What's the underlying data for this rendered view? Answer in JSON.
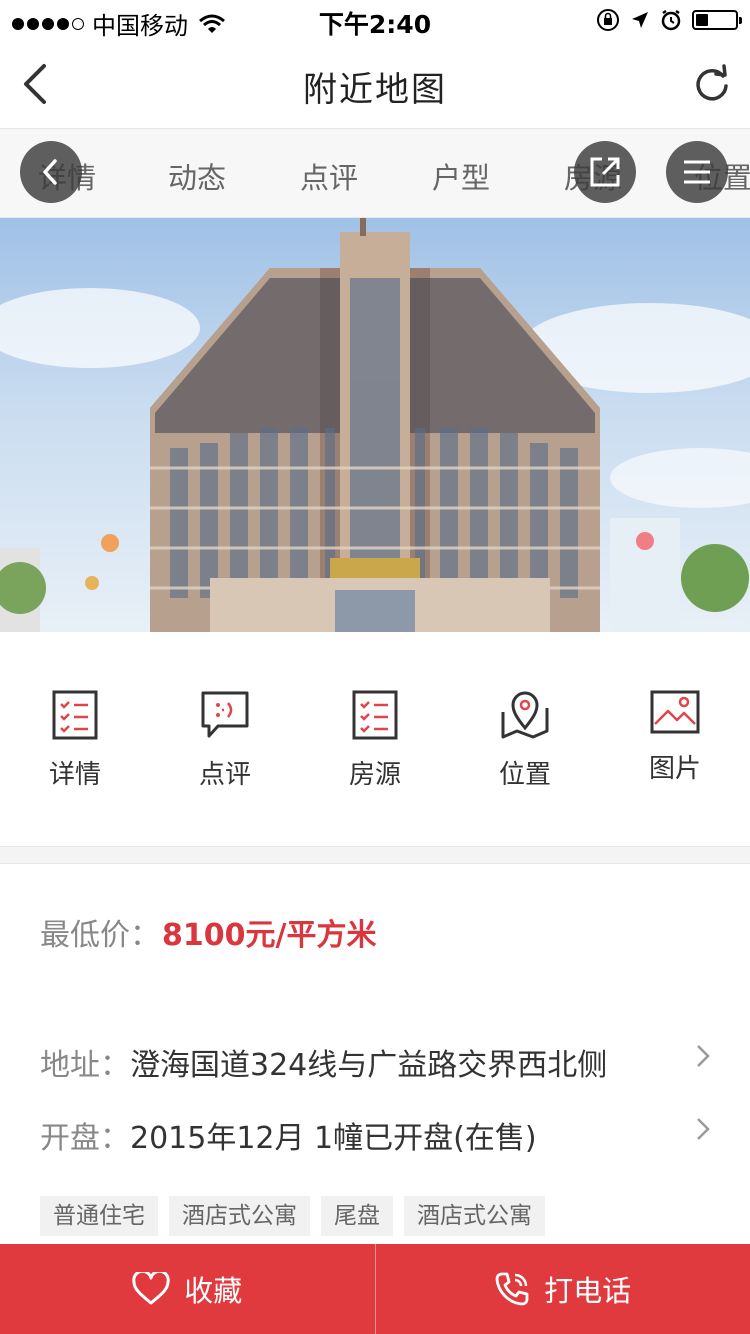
{
  "status_bar": {
    "carrier": "中国移动",
    "time": "下午2:40"
  },
  "nav": {
    "title": "附近地图"
  },
  "tabs": [
    "详情",
    "动态",
    "点评",
    "户型",
    "房源",
    "位置"
  ],
  "quick_actions": [
    {
      "label": "详情",
      "icon": "list-icon"
    },
    {
      "label": "点评",
      "icon": "comment-icon"
    },
    {
      "label": "房源",
      "icon": "list-icon"
    },
    {
      "label": "位置",
      "icon": "map-pin-icon"
    },
    {
      "label": "图片",
      "icon": "image-icon"
    }
  ],
  "price": {
    "label": "最低价：",
    "value": "8100元/平方米"
  },
  "address": {
    "label": "地址：",
    "value": "澄海国道324线与广益路交界西北侧"
  },
  "opening": {
    "label": "开盘：",
    "value": "2015年12月 1幢已开盘(在售)"
  },
  "tags": [
    "普通住宅",
    "酒店式公寓",
    "尾盘",
    "酒店式公寓"
  ],
  "bottom_bar": {
    "favorite_label": "收藏",
    "call_label": "打电话"
  },
  "colors": {
    "accent": "#e03a3f",
    "price": "#d9363e",
    "icon_red": "#e0454a"
  }
}
